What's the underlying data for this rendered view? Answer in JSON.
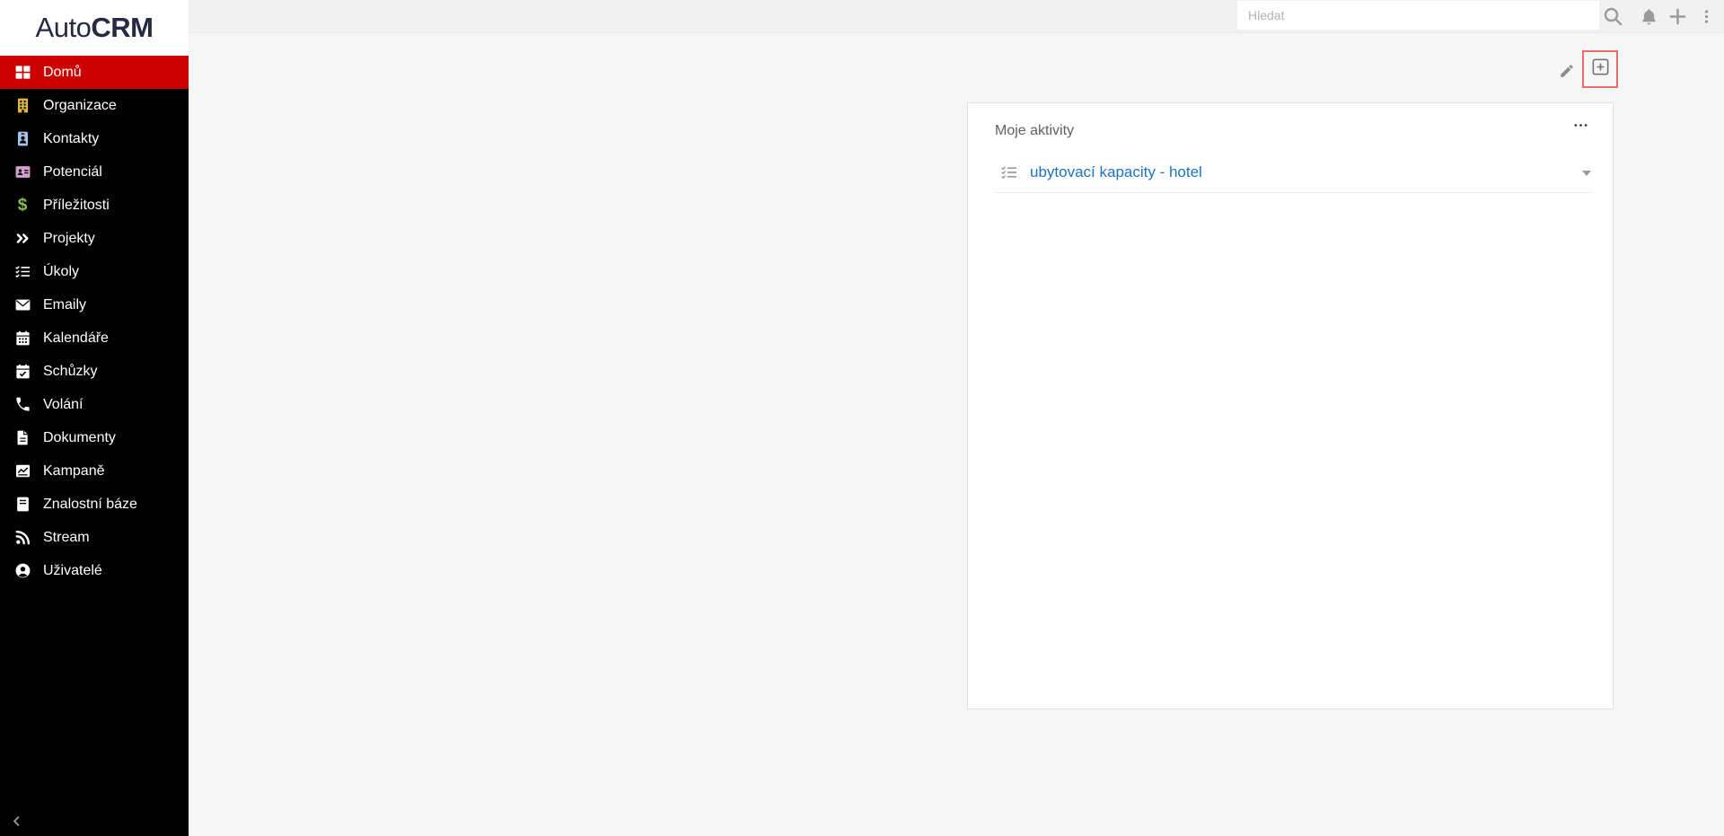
{
  "app": {
    "logo": {
      "prefix": "Auto",
      "suffix": "CRM"
    }
  },
  "colors": {
    "sidebar_bg": "#010101",
    "active_item_bg": "#cd0000",
    "topbar_bg": "#f1f1f1",
    "content_bg": "#f6f6f6",
    "link": "#1d72c2",
    "add_button_highlight": "#f16a6a",
    "topbar_icon_gray": "#9b9b9b"
  },
  "sidebar": {
    "items": [
      {
        "label": "Domů",
        "icon": "grid-icon",
        "color": "#ffffff",
        "active": true
      },
      {
        "label": "Organizace",
        "icon": "building-icon",
        "color": "#dfb445",
        "active": false
      },
      {
        "label": "Kontakty",
        "icon": "id-badge-icon",
        "color": "#a5c3e6",
        "active": false
      },
      {
        "label": "Potenciál",
        "icon": "address-card-icon",
        "color": "#d6a1d2",
        "active": false
      },
      {
        "label": "Příležitosti",
        "icon": "dollar-icon",
        "color": "#8abf57",
        "active": false
      },
      {
        "label": "Projekty",
        "icon": "double-chevron-right-icon",
        "color": "#ffffff",
        "active": false
      },
      {
        "label": "Úkoly",
        "icon": "list-check-icon",
        "color": "#ffffff",
        "active": false
      },
      {
        "label": "Emaily",
        "icon": "envelope-icon",
        "color": "#ffffff",
        "active": false
      },
      {
        "label": "Kalendáře",
        "icon": "calendar-icon",
        "color": "#ffffff",
        "active": false
      },
      {
        "label": "Schůzky",
        "icon": "calendar-check-icon",
        "color": "#ffffff",
        "active": false
      },
      {
        "label": "Volání",
        "icon": "phone-icon",
        "color": "#ffffff",
        "active": false
      },
      {
        "label": "Dokumenty",
        "icon": "file-icon",
        "color": "#ffffff",
        "active": false
      },
      {
        "label": "Kampaně",
        "icon": "chart-icon",
        "color": "#ffffff",
        "active": false
      },
      {
        "label": "Znalostní báze",
        "icon": "book-icon",
        "color": "#ffffff",
        "active": false
      },
      {
        "label": "Stream",
        "icon": "rss-icon",
        "color": "#ffffff",
        "active": false
      },
      {
        "label": "Uživatelé",
        "icon": "user-circle-icon",
        "color": "#ffffff",
        "active": false
      }
    ],
    "collapse_icon": "chevron-left-icon"
  },
  "topbar": {
    "search": {
      "placeholder": "Hledat",
      "value": ""
    },
    "icons": [
      "search-icon",
      "bell-icon",
      "plus-icon",
      "kebab-menu-icon"
    ]
  },
  "page": {
    "actions": {
      "edit_icon": "pencil-icon",
      "add_dashlet_icon": "plus-square-icon",
      "add_dashlet_highlighted": true
    }
  },
  "dashlet": {
    "title": "Moje aktivity",
    "menu_icon": "ellipsis-icon",
    "rows": [
      {
        "icon": "list-check-icon",
        "label": "ubytovací kapacity - hotel",
        "has_caret": true
      }
    ]
  }
}
